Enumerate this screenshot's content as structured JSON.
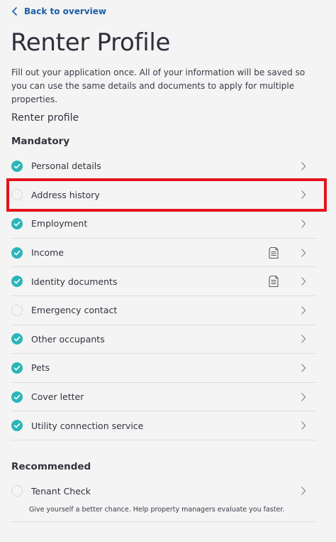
{
  "nav": {
    "back_label": "Back to overview"
  },
  "header": {
    "title": "Renter Profile",
    "intro": "Fill out your application once. All of your information will be saved so you can use the same details and documents to apply for multiple properties."
  },
  "section": {
    "title": "Renter profile"
  },
  "mandatory": {
    "title": "Mandatory",
    "items": [
      {
        "label": "Personal details",
        "status": "done",
        "has_document": false
      },
      {
        "label": "Address history",
        "status": "todo",
        "has_document": false
      },
      {
        "label": "Employment",
        "status": "done",
        "has_document": false
      },
      {
        "label": "Income",
        "status": "done",
        "has_document": true
      },
      {
        "label": "Identity documents",
        "status": "done",
        "has_document": true
      },
      {
        "label": "Emergency contact",
        "status": "todo",
        "has_document": false
      },
      {
        "label": "Other occupants",
        "status": "done",
        "has_document": false
      },
      {
        "label": "Pets",
        "status": "done",
        "has_document": false
      },
      {
        "label": "Cover letter",
        "status": "done",
        "has_document": false
      },
      {
        "label": "Utility connection service",
        "status": "done",
        "has_document": false
      }
    ]
  },
  "recommended": {
    "title": "Recommended",
    "items": [
      {
        "label": "Tenant Check",
        "status": "todo",
        "description": "Give yourself a better chance. Help property managers evaluate you faster."
      }
    ]
  },
  "colors": {
    "accent": "#2bb5b8",
    "link": "#1b5fa6",
    "highlight": "#e3131c"
  }
}
